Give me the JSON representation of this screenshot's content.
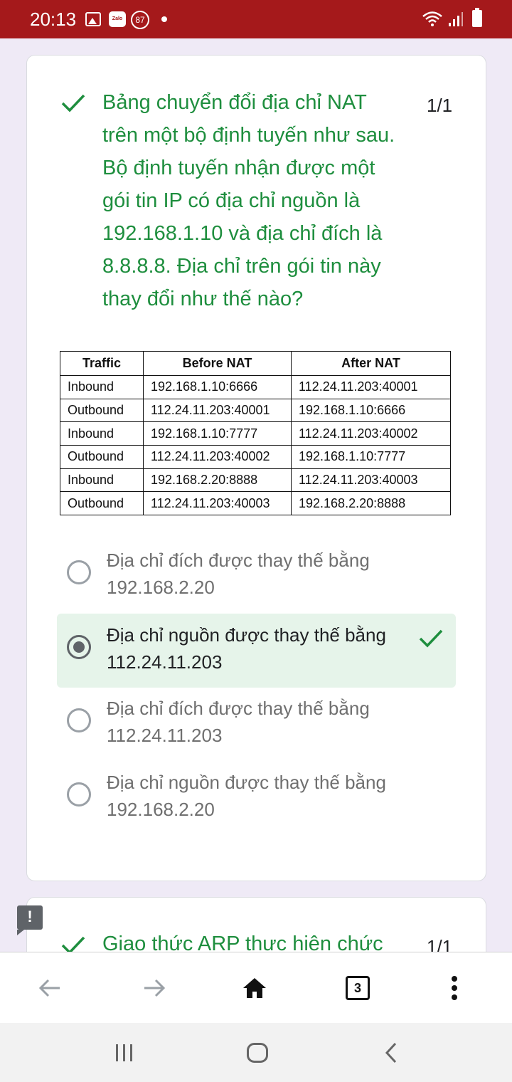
{
  "status_bar": {
    "time": "20:13",
    "zalo_label": "Zalo",
    "badge_count": "87"
  },
  "question_1": {
    "text": "Bảng chuyển đổi địa chỉ NAT\ntrên một bộ định tuyến như sau.\nBộ định tuyến nhận được một\ngói tin IP có địa chỉ nguồn là\n192.168.1.10 và địa chỉ đích là\n8.8.8.8. Địa chỉ trên gói tin này\nthay đổi như thế nào?",
    "score": "1/1",
    "table": {
      "headers": [
        "Traffic",
        "Before NAT",
        "After NAT"
      ],
      "rows": [
        [
          "Inbound",
          "192.168.1.10:6666",
          "112.24.11.203:40001"
        ],
        [
          "Outbound",
          "112.24.11.203:40001",
          "192.168.1.10:6666"
        ],
        [
          "Inbound",
          "192.168.1.10:7777",
          "112.24.11.203:40002"
        ],
        [
          "Outbound",
          "112.24.11.203:40002",
          "192.168.1.10:7777"
        ],
        [
          "Inbound",
          "192.168.2.20:8888",
          "112.24.11.203:40003"
        ],
        [
          "Outbound",
          "112.24.11.203:40003",
          "192.168.2.20:8888"
        ]
      ]
    },
    "options": [
      {
        "text": "Địa chỉ đích được thay thế bằng\n192.168.2.20",
        "selected": false,
        "correct": false
      },
      {
        "text": "Địa chỉ nguồn được thay thế bằng\n112.24.11.203",
        "selected": true,
        "correct": true
      },
      {
        "text": "Địa chỉ đích được thay thế bằng\n112.24.11.203",
        "selected": false,
        "correct": false
      },
      {
        "text": "Địa chỉ nguồn được thay thế bằng\n192.168.2.20",
        "selected": false,
        "correct": false
      }
    ]
  },
  "question_2": {
    "text": "Giao thức ARP thực hiện chức",
    "score": "1/1"
  },
  "feedback_label": "!",
  "toolbar": {
    "tab_count": "3"
  },
  "colors": {
    "status_bar": "#a5191b",
    "correct_green": "#1e8e3e",
    "correct_bg": "#e6f4ea",
    "page_bg": "#efeaf6"
  }
}
